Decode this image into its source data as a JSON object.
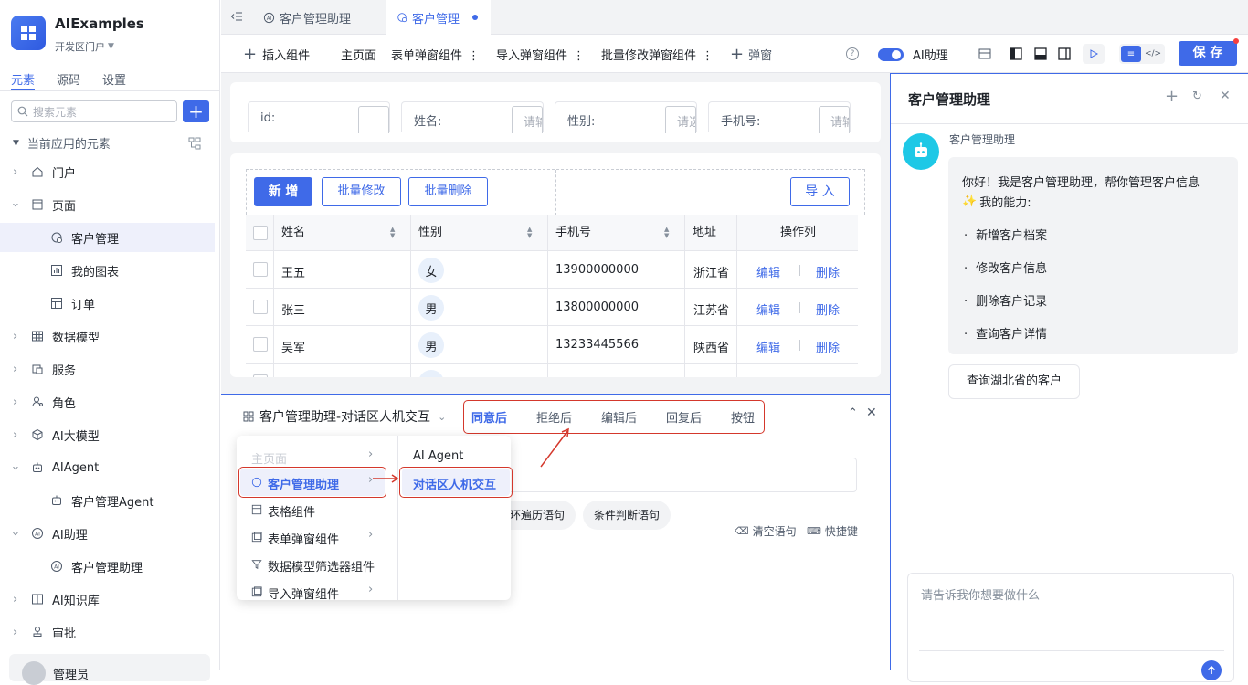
{
  "app": {
    "name": "AIExamples",
    "portal": "开发区门户"
  },
  "sidebar": {
    "tabs": [
      "元素",
      "源码",
      "设置"
    ],
    "search_placeholder": "搜索元素",
    "section_title": "当前应用的元素",
    "items": [
      {
        "label": "门户"
      },
      {
        "label": "页面"
      },
      {
        "label": "客户管理"
      },
      {
        "label": "我的图表"
      },
      {
        "label": "订单"
      },
      {
        "label": "数据模型"
      },
      {
        "label": "服务"
      },
      {
        "label": "角色"
      },
      {
        "label": "AI大模型"
      },
      {
        "label": "AIAgent"
      },
      {
        "label": "客户管理Agent"
      },
      {
        "label": "AI助理"
      },
      {
        "label": "客户管理助理"
      },
      {
        "label": "AI知识库"
      },
      {
        "label": "审批"
      }
    ],
    "footer_user": "管理员"
  },
  "tabs": [
    {
      "label": "客户管理助理"
    },
    {
      "label": "客户管理"
    }
  ],
  "toolbar": {
    "insert": "插入组件",
    "main_page": "主页面",
    "form_dialog": "表单弹窗组件",
    "import_dialog": "导入弹窗组件",
    "batch_dialog": "批量修改弹窗组件",
    "popup": "弹窗",
    "ai_toggle": "AI助理",
    "save": "保 存"
  },
  "filters": [
    {
      "label": "id:",
      "placeholder": ""
    },
    {
      "label": "姓名:",
      "placeholder": "请输"
    },
    {
      "label": "性别:",
      "placeholder": "请选"
    },
    {
      "label": "手机号:",
      "placeholder": "请输"
    }
  ],
  "table_buttons": {
    "add": "新 增",
    "batch_edit": "批量修改",
    "batch_delete": "批量删除",
    "import": "导 入"
  },
  "table": {
    "headers": [
      "姓名",
      "性别",
      "手机号",
      "地址",
      "操作列"
    ],
    "rows": [
      {
        "name": "王五",
        "gender": "女",
        "phone": "13900000000",
        "addr": "浙江省",
        "edit": "编辑",
        "del": "删除"
      },
      {
        "name": "张三",
        "gender": "男",
        "phone": "13800000000",
        "addr": "江苏省",
        "edit": "编辑",
        "del": "删除"
      },
      {
        "name": "吴军",
        "gender": "男",
        "phone": "13233445566",
        "addr": "陕西省",
        "edit": "编辑",
        "del": "删除"
      }
    ]
  },
  "bottom_panel": {
    "title": "客户管理助理-对话区人机交互",
    "event_tabs": [
      "同意后",
      "拒绝后",
      "编辑后",
      "回复后",
      "按钮"
    ],
    "menu_left": [
      "主页面",
      "客户管理助理",
      "表格组件",
      "表单弹窗组件",
      "数据模型筛选器组件",
      "导入弹窗组件"
    ],
    "menu_right": [
      "AI Agent",
      "对话区人机交互"
    ],
    "chips": [
      "环遍历语句",
      "条件判断语句"
    ],
    "clear": "清空语句",
    "shortcut": "快捷键"
  },
  "assistant": {
    "title": "客户管理助理",
    "bot_name": "客户管理助理",
    "greeting": "你好！我是客户管理助理，帮你管理客户信息",
    "abilities_title": "我的能力:",
    "abilities": [
      "新增客户档案",
      "修改客户信息",
      "删除客户记录",
      "查询客户详情"
    ],
    "suggestion": "查询湖北省的客户",
    "input_placeholder": "请告诉我你想要做什么"
  },
  "colors": {
    "primary": "#3f6ae8",
    "highlight_red": "#d4382c",
    "bot_avatar": "#1ec8e6"
  }
}
